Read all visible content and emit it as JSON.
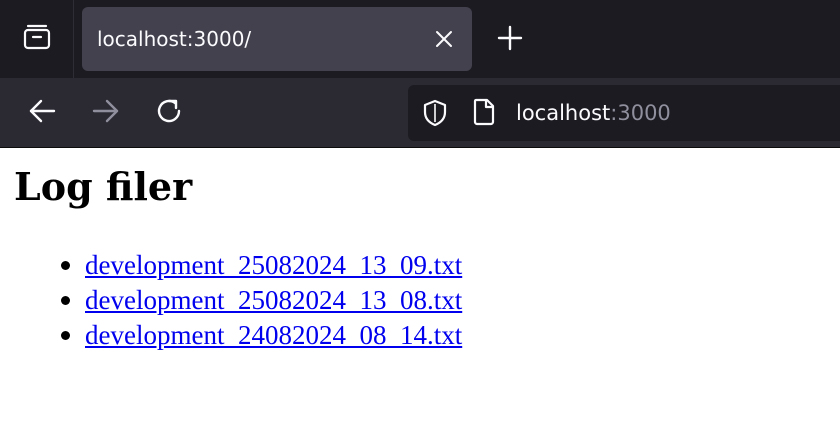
{
  "browser": {
    "tab_title": "localhost:3000/",
    "url_host": "localhost",
    "url_port": ":3000"
  },
  "page": {
    "heading": "Log filer",
    "files": [
      "development_25082024_13_09.txt",
      "development_25082024_13_08.txt",
      "development_24082024_08_14.txt"
    ]
  },
  "colors": {
    "tabbar_bg": "#1c1b22",
    "toolbar_bg": "#2b2a33",
    "link": "#0000ee"
  }
}
